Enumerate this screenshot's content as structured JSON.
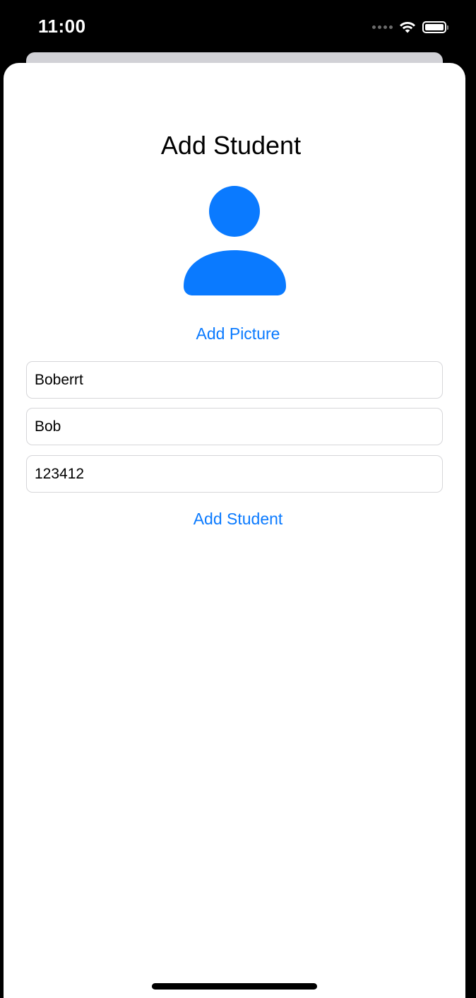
{
  "status_bar": {
    "time": "11:00",
    "icons": [
      "cellular-dots-icon",
      "wifi-icon",
      "battery-icon"
    ],
    "battery_level": 1.0
  },
  "form": {
    "title": "Add Student",
    "avatar_icon": "person-icon",
    "add_picture_label": "Add Picture",
    "fields": [
      {
        "value": "Boberrt"
      },
      {
        "value": "Bob"
      },
      {
        "value": "123412"
      }
    ],
    "submit_label": "Add Student"
  },
  "colors": {
    "accent": "#0a7aff",
    "background": "#000000",
    "sheet": "#ffffff"
  }
}
